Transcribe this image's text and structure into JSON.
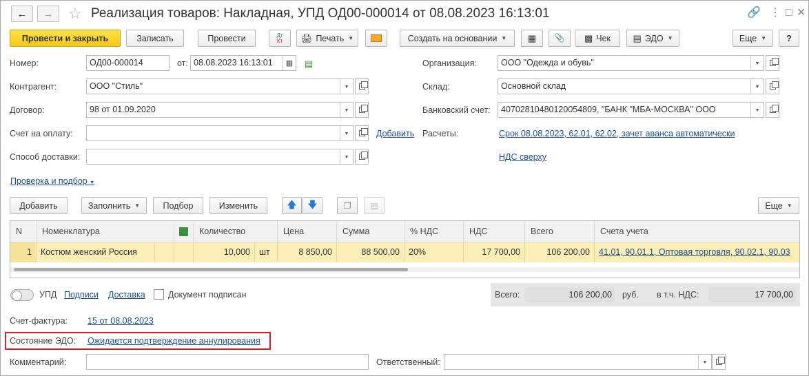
{
  "window": {
    "title": "Реализация товаров: Накладная, УПД ОД00-000014 от 08.08.2023 16:13:01"
  },
  "toolbar": {
    "post_close": "Провести и закрыть",
    "save": "Записать",
    "post": "Провести",
    "dtkt": "Дт Кт",
    "print": "Печать",
    "create_based": "Создать на основании",
    "check": "Чек",
    "edo": "ЭДО",
    "more": "Еще",
    "help": "?"
  },
  "form": {
    "number_label": "Номер:",
    "number_value": "ОД00-000014",
    "date_label": "от:",
    "date_value": "08.08.2023 16:13:01",
    "counterparty_label": "Контрагент:",
    "counterparty_value": "ООО \"Стиль\"",
    "contract_label": "Договор:",
    "contract_value": "98 от 01.09.2020",
    "invoice_label": "Счет на оплату:",
    "invoice_value": "",
    "add_link": "Добавить",
    "delivery_label": "Способ доставки:",
    "delivery_value": "",
    "org_label": "Организация:",
    "org_value": "ООО \"Одежда и обувь\"",
    "warehouse_label": "Склад:",
    "warehouse_value": "Основной склад",
    "bank_label": "Банковский счет:",
    "bank_value": "40702810480120054809, \"БАНК \"МБА-МОСКВА\" ООО",
    "settlements_label": "Расчеты:",
    "settlements_link": "Срок 08.08.2023, 62.01, 62.02, зачет аванса автоматически",
    "vat_link": "НДС сверху",
    "check_link": "Проверка и подбор"
  },
  "table_toolbar": {
    "add": "Добавить",
    "fill": "Заполнить",
    "pick": "Подбор",
    "change": "Изменить",
    "more": "Еще"
  },
  "table": {
    "headers": [
      "N",
      "Номенклатура",
      "",
      "Количество",
      "",
      "Цена",
      "Сумма",
      "% НДС",
      "НДС",
      "Всего",
      "Счета учета"
    ],
    "row": {
      "n": "1",
      "item": "Костюм женский Россия",
      "qty": "10,000",
      "unit": "шт",
      "price": "8 850,00",
      "sum": "88 500,00",
      "vat_rate": "20%",
      "vat": "17 700,00",
      "total": "106 200,00",
      "accounts": "41.01, 90.01.1, Оптовая торговля, 90.02.1, 90.03"
    }
  },
  "footer": {
    "upd_label": "УПД",
    "signatures_link": "Подписи",
    "delivery_link": "Доставка",
    "signed_label": "Документ подписан",
    "total_label": "Всего:",
    "total_value": "106 200,00",
    "currency": "руб.",
    "vat_incl_label": "в т.ч. НДС:",
    "vat_incl_value": "17 700,00",
    "invoice_doc_label": "Счет-фактура:",
    "invoice_doc_link": "15 от 08.08.2023",
    "edo_state_label": "Состояние ЭДО:",
    "edo_state_link": "Ожидается подтверждение аннулирования",
    "comment_label": "Комментарий:",
    "comment_value": "",
    "responsible_label": "Ответственный:",
    "responsible_value": ""
  },
  "colors": {
    "primary_button": "#f5c718",
    "selected_row": "#fbeeb7",
    "link": "#1f4f8b",
    "highlight_border": "#c62828"
  }
}
